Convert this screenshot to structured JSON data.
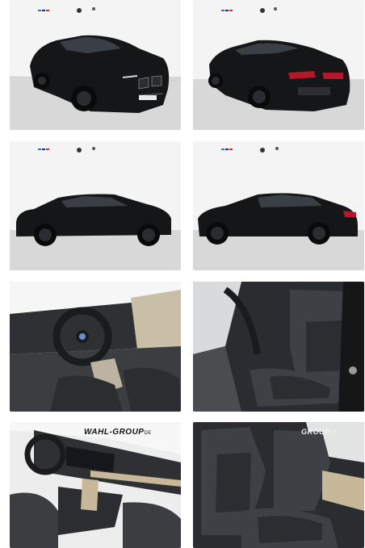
{
  "gallery": {
    "photos": [
      {
        "subject": "front-three-quarter exterior"
      },
      {
        "subject": "rear-three-quarter exterior"
      },
      {
        "subject": "left side exterior"
      },
      {
        "subject": "right side exterior"
      },
      {
        "subject": "cockpit and steering wheel"
      },
      {
        "subject": "driver seat"
      },
      {
        "subject": "dashboard and center console"
      },
      {
        "subject": "front sport seat"
      }
    ],
    "watermarks": [
      {
        "brand": "WAHL",
        "sep": "-",
        "name": "GROUP",
        "suffix": "DE"
      }
    ]
  },
  "colors": {
    "car_paint": "#141618",
    "showroom_wall": "#f3f3f3",
    "floor": "#d9d9d9",
    "upholstery": "#2b2d30",
    "trim": "#c7b89a"
  }
}
